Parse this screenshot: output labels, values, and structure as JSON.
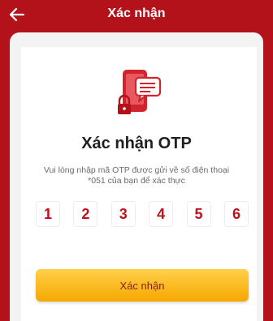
{
  "header": {
    "title": "Xác nhận",
    "back_icon": "back-arrow-icon"
  },
  "illustration": {
    "icon": "phone-message-lock-icon",
    "color": "#d3242d"
  },
  "otp": {
    "title": "Xác nhận OTP",
    "description_line1": "Vui lòng nhập mã OTP được gửi về số điện thoại",
    "description_line2": "*051 của bạn để xác thực",
    "digits": [
      "1",
      "2",
      "3",
      "4",
      "5",
      "6"
    ]
  },
  "confirm_button": {
    "label": "Xác nhận"
  },
  "colors": {
    "brand_red": "#b3121b",
    "digit_red": "#c0121b",
    "button_yellow": "#f6b21e"
  }
}
